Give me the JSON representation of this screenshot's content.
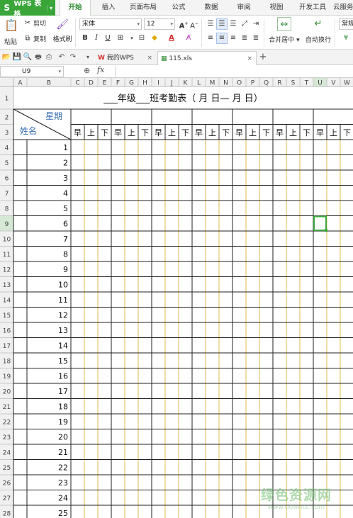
{
  "app": {
    "title": "WPS 表格",
    "accent": "#3aa63a"
  },
  "menu": {
    "tabs": [
      "开始",
      "插入",
      "页面布局",
      "公式",
      "数据",
      "审阅",
      "视图",
      "开发工具",
      "云服务"
    ],
    "active": "开始"
  },
  "ribbon": {
    "paste": "粘贴",
    "cut": "剪切",
    "copy": "复制",
    "format_painter": "格式刷",
    "font_name": "宋体",
    "font_size": "12",
    "bold": "B",
    "italic": "I",
    "underline": "U",
    "merge_center": "合并居中",
    "wrap_text": "自动换行",
    "number_format": "常规"
  },
  "doc_tabs": [
    {
      "label": "我的WPS",
      "active": false
    },
    {
      "label": "115.xls",
      "active": true
    }
  ],
  "formula_bar": {
    "cell_ref": "U9",
    "fx": "fx"
  },
  "sheet": {
    "columns": [
      "A",
      "B",
      "C",
      "D",
      "E",
      "F",
      "G",
      "H",
      "I",
      "J",
      "K",
      "L",
      "M",
      "N",
      "O",
      "P",
      "Q",
      "R",
      "S",
      "T",
      "U",
      "V",
      "W"
    ],
    "rows": [
      "1",
      "2",
      "3",
      "4",
      "5",
      "6",
      "7",
      "8",
      "9",
      "10",
      "11",
      "12",
      "13",
      "14",
      "15",
      "16",
      "17",
      "18",
      "19",
      "20",
      "21",
      "22",
      "23",
      "24",
      "25",
      "26",
      "27",
      "28"
    ],
    "selected_column": "U",
    "selected_row": "9",
    "title": "___年级___班考勤表（     月    日—    月    日）",
    "header_week": "星期",
    "header_name": "姓名",
    "periods": [
      "早",
      "上",
      "下",
      "早",
      "上",
      "下",
      "早",
      "上",
      "下",
      "早",
      "上",
      "下",
      "早",
      "上",
      "下",
      "早",
      "上",
      "下",
      "早",
      "上",
      "下"
    ],
    "student_numbers": [
      "1",
      "2",
      "3",
      "4",
      "5",
      "6",
      "7",
      "8",
      "9",
      "10",
      "11",
      "12",
      "13",
      "14",
      "15",
      "16",
      "17",
      "18",
      "19",
      "20",
      "21",
      "22",
      "23",
      "24",
      "25"
    ]
  },
  "watermark": {
    "line1": "绿色资源网",
    "line2": "www.downcc.com"
  }
}
